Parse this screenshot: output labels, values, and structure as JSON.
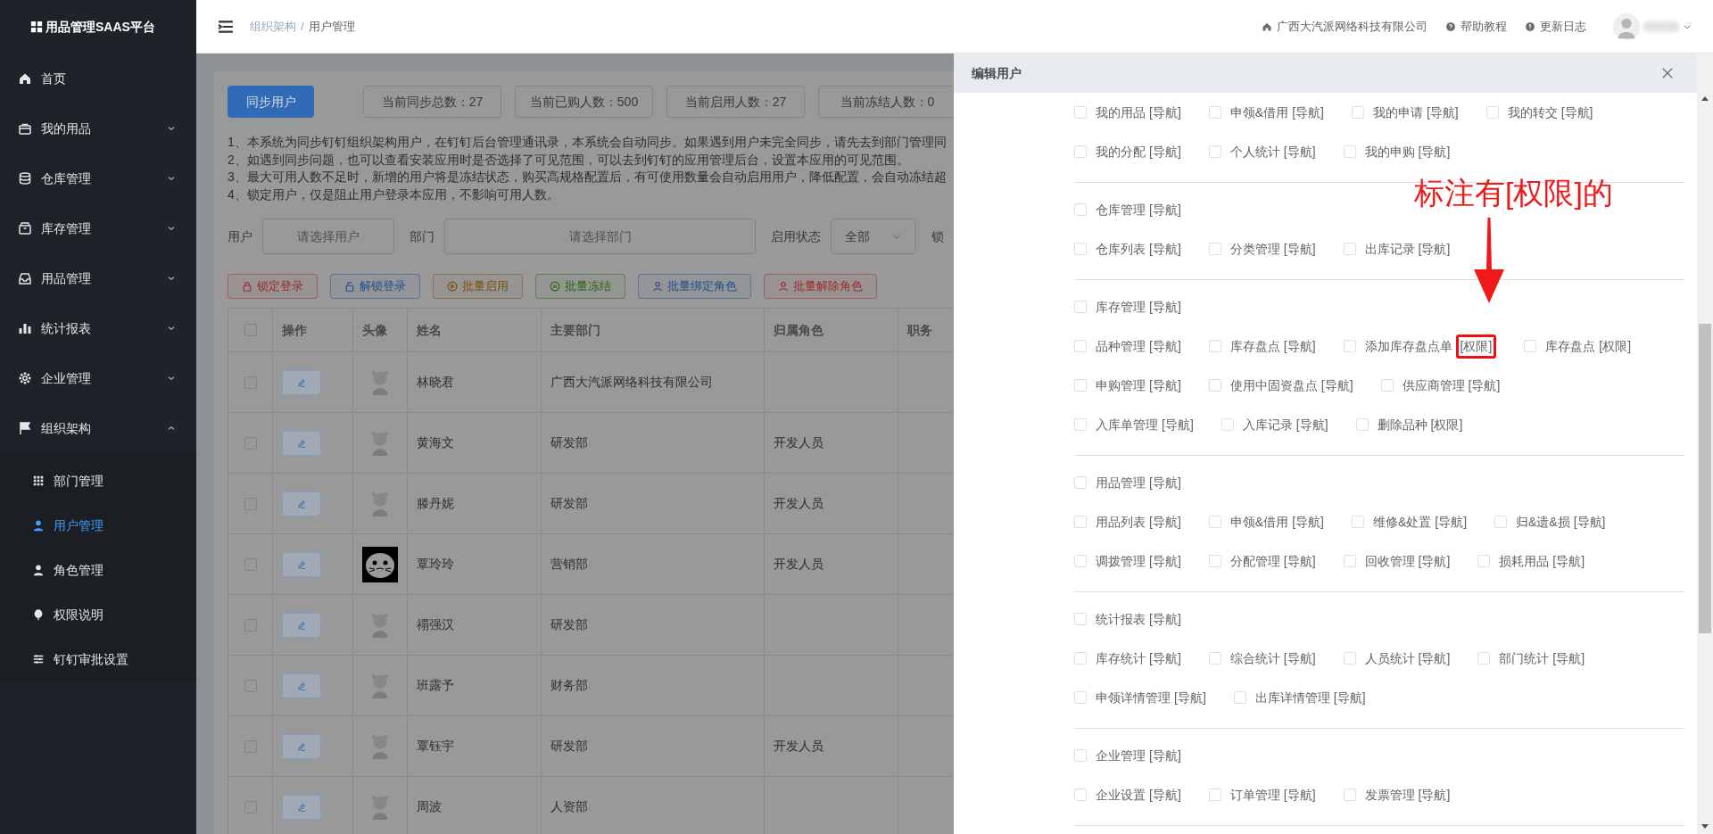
{
  "sidebar": {
    "logo": "用品管理SAAS平台",
    "items": [
      {
        "kind": "link",
        "label": "首页"
      },
      {
        "kind": "group",
        "label": "我的用品",
        "expanded": false
      },
      {
        "kind": "group",
        "label": "仓库管理",
        "expanded": false
      },
      {
        "kind": "group",
        "label": "库存管理",
        "expanded": false
      },
      {
        "kind": "group",
        "label": "用品管理",
        "expanded": false
      },
      {
        "kind": "group",
        "label": "统计报表",
        "expanded": false
      },
      {
        "kind": "group",
        "label": "企业管理",
        "expanded": false
      },
      {
        "kind": "group",
        "label": "组织架构",
        "expanded": true,
        "children": [
          {
            "label": "部门管理",
            "selected": false
          },
          {
            "label": "用户管理",
            "selected": true
          },
          {
            "label": "角色管理",
            "selected": false
          },
          {
            "label": "权限说明",
            "selected": false
          },
          {
            "label": "钉钉审批设置",
            "selected": false
          }
        ]
      }
    ]
  },
  "header": {
    "breadcrumb": [
      "组织架构",
      "用户管理"
    ],
    "breadcrumb_separator": "/",
    "links": [
      "广西大汽派网络科技有限公司",
      "帮助教程",
      "更新日志"
    ]
  },
  "main": {
    "sync_button": "同步用户",
    "stats": [
      "当前同步总数：27",
      "当前已购人数：500",
      "当前启用人数：27",
      "当前冻结人数：0"
    ],
    "notes": [
      "1、本系统为同步钉钉组织架构用户，在钉钉后台管理通讯录，本系统会自动同步。如果遇到用户未完全同步，请先去到部门管理同",
      "2、如遇到同步问题，也可以查看安装应用时是否选择了可见范围，可以去到钉钉的应用管理后台，设置本应用的可见范围。",
      "3、最大可用人数不足时，新增的用户将是冻结状态，购买高规格配置后，有可使用数量会自动启用用户，降低配置，会自动冻结超",
      "4、锁定用户，仅是阻止用户登录本应用，不影响可用人数。"
    ],
    "filters": {
      "user_label": "用户",
      "user_placeholder": "请选择用户",
      "dept_label": "部门",
      "dept_placeholder": "请选择部门",
      "status_label": "启用状态",
      "status_value": "全部",
      "lock_label": "锁"
    },
    "actions": [
      {
        "label": "锁定登录",
        "color": "#a02828"
      },
      {
        "label": "解锁登录",
        "color": "#234f8c"
      },
      {
        "label": "批量启用",
        "color": "#7a4e0c"
      },
      {
        "label": "批量冻结",
        "color": "#2a6410"
      },
      {
        "label": "批量绑定角色",
        "color": "#234f8c"
      },
      {
        "label": "批量解除角色",
        "color": "#a02828"
      }
    ],
    "table": {
      "select_all_checked": false,
      "columns": [
        "操作",
        "头像",
        "姓名",
        "主要部门",
        "归属角色",
        "职务"
      ],
      "rows": [
        {
          "checked": false,
          "kind": "default",
          "name": "林晓君",
          "department": "广西大汽派网络科技有限公司"
        },
        {
          "checked": false,
          "kind": "default",
          "name": "黄海文",
          "department": "研发部",
          "role": "开发人员"
        },
        {
          "checked": false,
          "kind": "default",
          "name": "滕丹妮",
          "department": "研发部",
          "role": "开发人员"
        },
        {
          "checked": false,
          "kind": "cartoon",
          "name": "覃玲玲",
          "department": "营销部",
          "role": "开发人员"
        },
        {
          "checked": false,
          "kind": "default",
          "name": "禤强汉",
          "department": "研发部"
        },
        {
          "checked": false,
          "kind": "default",
          "name": "班露予",
          "department": "财务部"
        },
        {
          "checked": false,
          "kind": "default",
          "name": "覃钰宇",
          "department": "研发部",
          "role": "开发人员"
        },
        {
          "checked": false,
          "kind": "default",
          "name": "周波",
          "department": "人资部"
        }
      ]
    }
  },
  "drawer": {
    "title": "编辑用户",
    "annotation": "标注有[权限]的",
    "sections": [
      {
        "rows": [
          [
            {
              "name": "我的用品",
              "tag": "[导航]",
              "checked": false,
              "highlighted": false
            },
            {
              "name": "申领&借用",
              "tag": "[导航]",
              "checked": false,
              "highlighted": false
            },
            {
              "name": "我的申请",
              "tag": "[导航]",
              "checked": false,
              "highlighted": false
            },
            {
              "name": "我的转交",
              "tag": "[导航]",
              "checked": false,
              "highlighted": false
            }
          ],
          [
            {
              "name": "我的分配",
              "tag": "[导航]",
              "checked": false,
              "highlighted": false
            },
            {
              "name": "个人统计",
              "tag": "[导航]",
              "checked": false,
              "highlighted": false
            },
            {
              "name": "我的申购",
              "tag": "[导航]",
              "checked": false,
              "highlighted": false
            }
          ]
        ]
      },
      {
        "rows": [
          [
            {
              "name": "仓库管理",
              "tag": "[导航]",
              "checked": false,
              "highlighted": false
            }
          ],
          [
            {
              "name": "仓库列表",
              "tag": "[导航]",
              "checked": false,
              "highlighted": false
            },
            {
              "name": "分类管理",
              "tag": "[导航]",
              "checked": false,
              "highlighted": false
            },
            {
              "name": "出库记录",
              "tag": "[导航]",
              "checked": false,
              "highlighted": false
            }
          ]
        ]
      },
      {
        "rows": [
          [
            {
              "name": "库存管理",
              "tag": "[导航]",
              "checked": false,
              "highlighted": false
            }
          ],
          [
            {
              "name": "品种管理",
              "tag": "[导航]",
              "checked": false,
              "highlighted": false
            },
            {
              "name": "库存盘点",
              "tag": "[导航]",
              "checked": false,
              "highlighted": false
            },
            {
              "name": "添加库存盘点单",
              "tag": "[权限]",
              "checked": false,
              "highlighted": true
            },
            {
              "name": "库存盘点",
              "tag": "[权限]",
              "checked": false,
              "highlighted": false
            }
          ],
          [
            {
              "name": "申购管理",
              "tag": "[导航]",
              "checked": false,
              "highlighted": false
            },
            {
              "name": "使用中固资盘点",
              "tag": "[导航]",
              "checked": false,
              "highlighted": false
            },
            {
              "name": "供应商管理",
              "tag": "[导航]",
              "checked": false,
              "highlighted": false
            }
          ],
          [
            {
              "name": "入库单管理",
              "tag": "[导航]",
              "checked": false,
              "highlighted": false
            },
            {
              "name": "入库记录",
              "tag": "[导航]",
              "checked": false,
              "highlighted": false
            },
            {
              "name": "删除品种",
              "tag": "[权限]",
              "checked": false,
              "highlighted": false
            }
          ]
        ]
      },
      {
        "rows": [
          [
            {
              "name": "用品管理",
              "tag": "[导航]",
              "checked": false,
              "highlighted": false
            }
          ],
          [
            {
              "name": "用品列表",
              "tag": "[导航]",
              "checked": false,
              "highlighted": false
            },
            {
              "name": "申领&借用",
              "tag": "[导航]",
              "checked": false,
              "highlighted": false
            },
            {
              "name": "维修&处置",
              "tag": "[导航]",
              "checked": false,
              "highlighted": false
            },
            {
              "name": "归&遗&损",
              "tag": "[导航]",
              "checked": false,
              "highlighted": false
            }
          ],
          [
            {
              "name": "调拨管理",
              "tag": "[导航]",
              "checked": false,
              "highlighted": false
            },
            {
              "name": "分配管理",
              "tag": "[导航]",
              "checked": false,
              "highlighted": false
            },
            {
              "name": "回收管理",
              "tag": "[导航]",
              "checked": false,
              "highlighted": false
            },
            {
              "name": "损耗用品",
              "tag": "[导航]",
              "checked": false,
              "highlighted": false
            }
          ]
        ]
      },
      {
        "rows": [
          [
            {
              "name": "统计报表",
              "tag": "[导航]",
              "checked": false,
              "highlighted": false
            }
          ],
          [
            {
              "name": "库存统计",
              "tag": "[导航]",
              "checked": false,
              "highlighted": false
            },
            {
              "name": "综合统计",
              "tag": "[导航]",
              "checked": false,
              "highlighted": false
            },
            {
              "name": "人员统计",
              "tag": "[导航]",
              "checked": false,
              "highlighted": false
            },
            {
              "name": "部门统计",
              "tag": "[导航]",
              "checked": false,
              "highlighted": false
            }
          ],
          [
            {
              "name": "申领详情管理",
              "tag": "[导航]",
              "checked": false,
              "highlighted": false
            },
            {
              "name": "出库详情管理",
              "tag": "[导航]",
              "checked": false,
              "highlighted": false
            }
          ]
        ]
      },
      {
        "rows": [
          [
            {
              "name": "企业管理",
              "tag": "[导航]",
              "checked": false,
              "highlighted": false
            }
          ],
          [
            {
              "name": "企业设置",
              "tag": "[导航]",
              "checked": false,
              "highlighted": false
            },
            {
              "name": "订单管理",
              "tag": "[导航]",
              "checked": false,
              "highlighted": false
            },
            {
              "name": "发票管理",
              "tag": "[导航]",
              "checked": false,
              "highlighted": false
            }
          ]
        ]
      }
    ]
  }
}
